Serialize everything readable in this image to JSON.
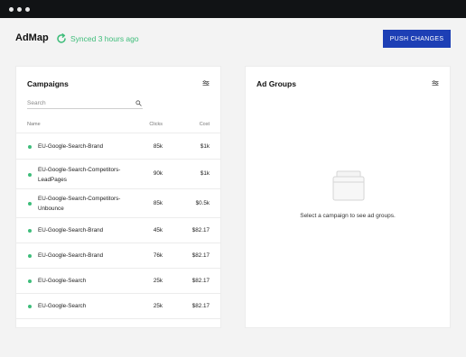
{
  "header": {
    "app_title": "AdMap",
    "sync_status": "Synced 3 hours ago",
    "push_button": "PUSH CHANGES"
  },
  "campaigns": {
    "title": "Campaigns",
    "search_placeholder": "Search",
    "columns": {
      "name": "Name",
      "clicks": "Clicks",
      "cost": "Cost"
    },
    "rows": [
      {
        "name": "EU-Google-Search-Brand",
        "clicks": "85k",
        "cost": "$1k"
      },
      {
        "name": "EU-Google-Search-Competitors-LeadPages",
        "clicks": "90k",
        "cost": "$1k"
      },
      {
        "name": "EU-Google-Search-Competitors-Unbounce",
        "clicks": "85k",
        "cost": "$0.5k"
      },
      {
        "name": "EU-Google-Search-Brand",
        "clicks": "45k",
        "cost": "$82.17"
      },
      {
        "name": "EU-Google-Search-Brand",
        "clicks": "76k",
        "cost": "$82.17"
      },
      {
        "name": "EU-Google-Search",
        "clicks": "25k",
        "cost": "$82.17"
      },
      {
        "name": "EU-Google-Search",
        "clicks": "25k",
        "cost": "$82.17"
      }
    ]
  },
  "ad_groups": {
    "title": "Ad Groups",
    "empty_message": "Select a campaign to see ad groups."
  },
  "colors": {
    "accent": "#1d3fb5",
    "status_green": "#3ebd7a",
    "titlebar": "#111315"
  },
  "icons": {
    "sync": "refresh-icon",
    "filter": "filter-icon",
    "search": "search-icon",
    "empty": "folder-icon"
  }
}
